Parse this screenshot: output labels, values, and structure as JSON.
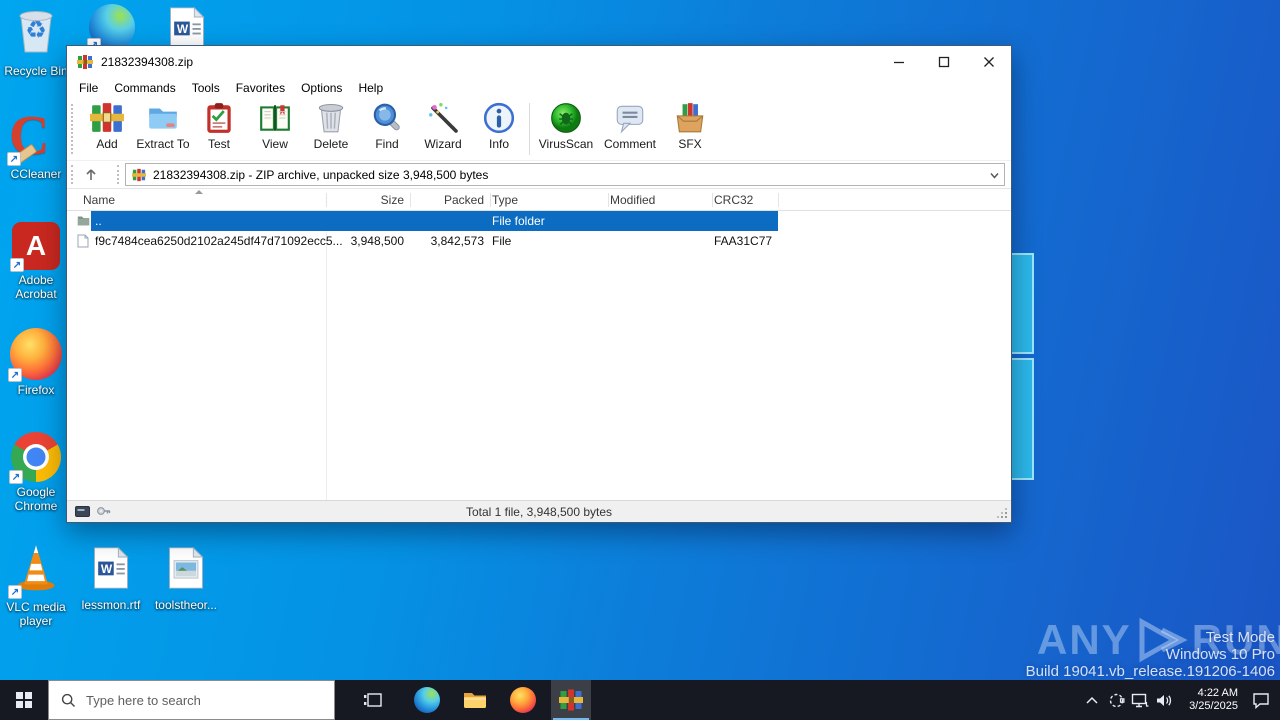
{
  "desktop": {
    "icons": {
      "recycle_bin": "Recycle Bin",
      "ccleaner": "CCleaner",
      "adobe": "Adobe Acrobat",
      "firefox": "Firefox",
      "chrome": "Google Chrome",
      "vlc": "VLC media player",
      "lessmon": "lessmon.rtf",
      "toolstheor": "toolstheor..."
    }
  },
  "winrar": {
    "title": "21832394308.zip",
    "menu": [
      "File",
      "Commands",
      "Tools",
      "Favorites",
      "Options",
      "Help"
    ],
    "toolbar": [
      "Add",
      "Extract To",
      "Test",
      "View",
      "Delete",
      "Find",
      "Wizard",
      "Info",
      "VirusScan",
      "Comment",
      "SFX"
    ],
    "address": "21832394308.zip - ZIP archive, unpacked size 3,948,500 bytes",
    "columns": [
      "Name",
      "Size",
      "Packed",
      "Type",
      "Modified",
      "CRC32"
    ],
    "rows": [
      {
        "name": "..",
        "size": "",
        "packed": "",
        "type": "File folder",
        "modified": "",
        "crc32": ""
      },
      {
        "name": "f9c7484cea6250d2102a245df47d71092ecc5...",
        "size": "3,948,500",
        "packed": "3,842,573",
        "type": "File",
        "modified": "",
        "crc32": "FAA31C77"
      }
    ],
    "status_total": "Total 1 file, 3,948,500 bytes"
  },
  "taskbar": {
    "search_placeholder": "Type here to search"
  },
  "tray": {
    "time": "4:22 AM",
    "date": "3/25/2025"
  },
  "watermark": {
    "brand_left": "ANY",
    "brand_right": "RUN",
    "mode": "Test Mode",
    "os": "Windows 10 Pro",
    "build": "Build 19041.vb_release.191206-1406"
  },
  "glyphs": {
    "recycle": "♻",
    "shortcut": "↗",
    "word_w": "W",
    "ccleaner_c": "C",
    "adobe_a": "A"
  },
  "colors": {
    "selection": "#0b6cc1",
    "desktop_left": "#00a6ef",
    "desktop_right": "#1b55c5",
    "taskbar": "#161922"
  }
}
